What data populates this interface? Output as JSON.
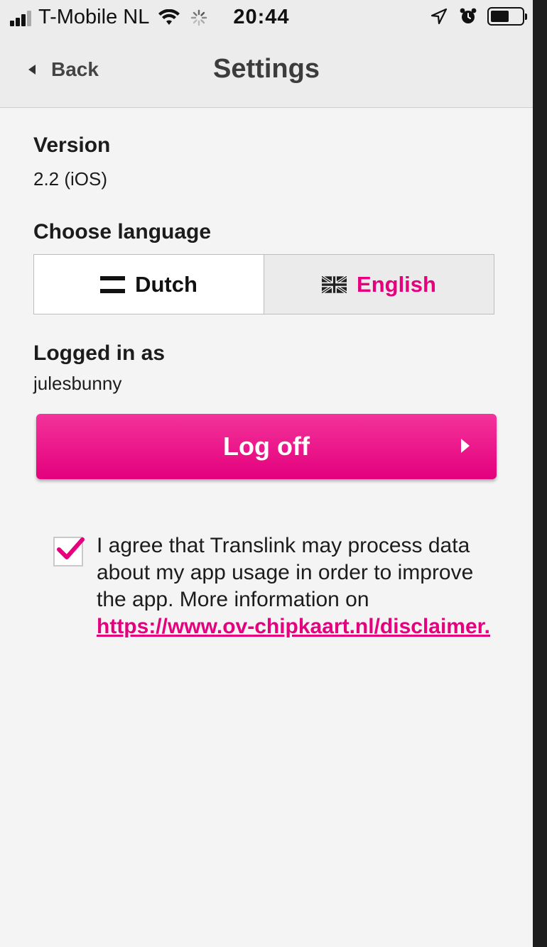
{
  "status_bar": {
    "carrier": "T-Mobile NL",
    "time": "20:44",
    "signal_icon": "signal-bars-icon",
    "wifi_icon": "wifi-icon",
    "activity_icon": "loading-spinner-icon",
    "location_icon": "location-arrow-icon",
    "alarm_icon": "alarm-clock-icon",
    "battery_icon": "battery-icon",
    "battery_level": 0.6
  },
  "nav": {
    "back_label": "Back",
    "title": "Settings"
  },
  "version": {
    "heading": "Version",
    "value": "2.2 (iOS)"
  },
  "language": {
    "heading": "Choose language",
    "options": [
      {
        "label": "Dutch",
        "icon": "flag-netherlands-icon",
        "selected": false
      },
      {
        "label": "English",
        "icon": "flag-uk-icon",
        "selected": true
      }
    ]
  },
  "account": {
    "heading": "Logged in as",
    "username": "julesbunny",
    "logoff_label": "Log off"
  },
  "consent": {
    "checked": true,
    "text": "I agree that Translink may process data about my app usage in order to improve the app. More information on",
    "link": "https://www.ov-chipkaart.nl/disclaimer."
  },
  "colors": {
    "accent": "#e6007e",
    "background": "#f4f4f4",
    "navbar": "#ececec"
  }
}
